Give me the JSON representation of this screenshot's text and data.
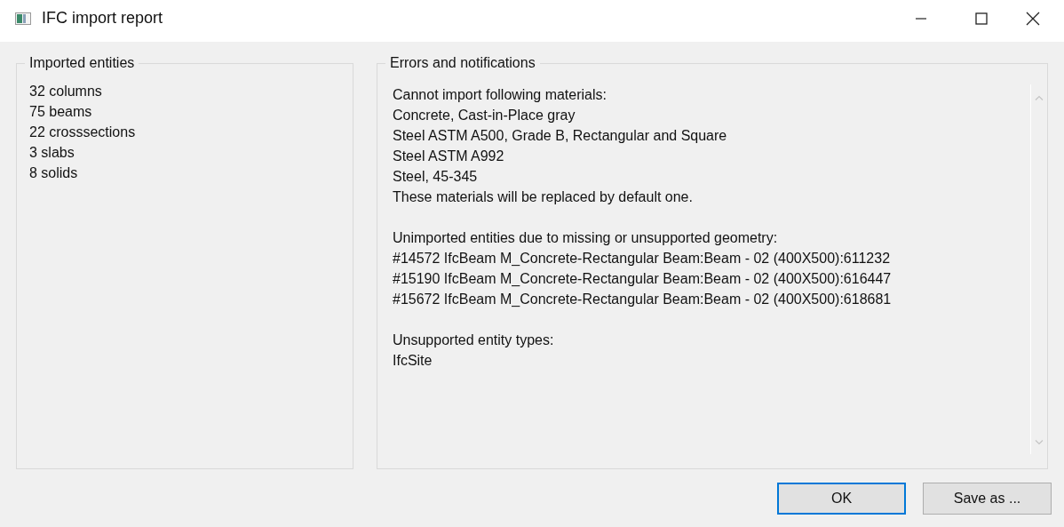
{
  "window": {
    "title": "IFC import report"
  },
  "imported_entities": {
    "title": "Imported entities",
    "lines": [
      "32 columns",
      "75 beams",
      "22 crosssections",
      "3 slabs",
      "8 solids"
    ]
  },
  "errors": {
    "title": "Errors and notifications",
    "paragraphs": [
      {
        "lines": [
          "Cannot import following materials:",
          "Concrete, Cast-in-Place gray",
          "Steel ASTM A500, Grade B, Rectangular and Square",
          "Steel ASTM A992",
          "Steel, 45-345",
          "These materials will be replaced by default one."
        ]
      },
      {
        "lines": [
          "Unimported entities due to missing or unsupported geometry:",
          "#14572 IfcBeam M_Concrete-Rectangular Beam:Beam - 02 (400X500):611232",
          "#15190 IfcBeam M_Concrete-Rectangular Beam:Beam - 02 (400X500):616447",
          "#15672 IfcBeam M_Concrete-Rectangular Beam:Beam - 02 (400X500):618681"
        ]
      },
      {
        "lines": [
          "Unsupported entity types:",
          "IfcSite"
        ]
      }
    ]
  },
  "buttons": [
    {
      "label": "OK",
      "default": true
    },
    {
      "label": "Save as ...",
      "default": false
    }
  ]
}
